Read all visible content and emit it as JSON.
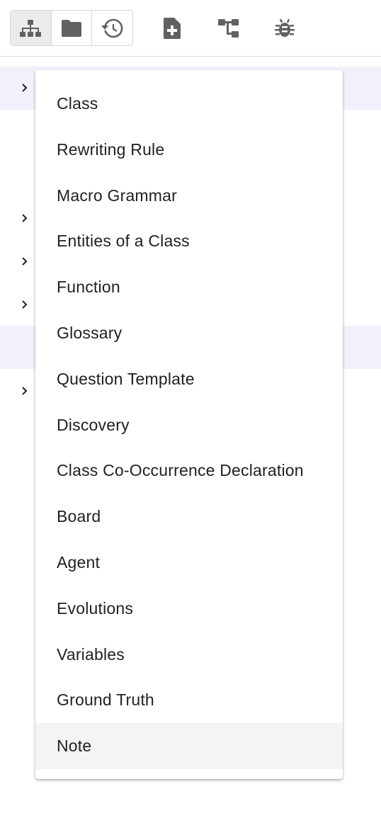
{
  "toolbar": {
    "group_buttons": [
      {
        "icon": "sitemap-icon",
        "active": true
      },
      {
        "icon": "folder-icon",
        "active": false
      },
      {
        "icon": "history-icon",
        "active": false
      }
    ],
    "buttons": [
      {
        "icon": "file-plus-icon"
      },
      {
        "icon": "diagram-tree-icon"
      },
      {
        "icon": "bug-icon"
      }
    ]
  },
  "menu": {
    "items": [
      "Class",
      "Rewriting Rule",
      "Macro Grammar",
      "Entities of a Class",
      "Function",
      "Glossary",
      "Question Template",
      "Discovery",
      "Class Co-Occurrence Declaration",
      "Board",
      "Agent",
      "Evolutions",
      "Variables",
      "Ground Truth",
      "Note"
    ],
    "selected": "Note"
  },
  "colors": {
    "icon": "#616161",
    "row_highlight": "#f3effb",
    "selected_item": "#f4f4f4"
  }
}
